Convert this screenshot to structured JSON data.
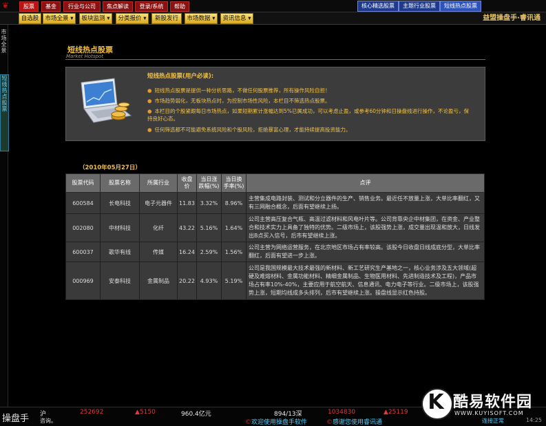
{
  "top_tabs": [
    {
      "label": "股票",
      "active": true
    },
    {
      "label": "基金",
      "active": false
    },
    {
      "label": "行业与公司",
      "active": false
    },
    {
      "label": "焦点解读",
      "active": false
    },
    {
      "label": "登录/系统",
      "active": false
    },
    {
      "label": "帮助",
      "active": false
    }
  ],
  "right_tabs": [
    "核心精选股票",
    "主题行业股票",
    "短线热点股票"
  ],
  "menu": [
    "自选股",
    "市场全景 ▾",
    "板块监测 ▾",
    "分类报价 ▾",
    "新股发行",
    "市场数据 ▾",
    "资讯信息 ▾"
  ],
  "brand": "益盟操盘手·睿讯通",
  "left_tabs": [
    {
      "label": "市场全景",
      "selected": false
    },
    {
      "label": "短线热点股票",
      "selected": true
    }
  ],
  "page": {
    "title": "短线热点股票",
    "subtitle": "Market Hotspot"
  },
  "notice": {
    "title": "短线热点股票(用户必读):",
    "items": [
      "短线热点股票是提供一种分析思路，不做任何股票推荐，所有操作风险自担！",
      "市场趋势弱化，无板块热点时，为控制市场性风险，本栏目不筛选热点股票。",
      "本栏目的个股紧跟每日市场热点，如果短期累计涨幅达到5%已属成功，可以考虑止盈，或参考60分钟和日操盘线进行操作，不论盈亏，保持良好心态。",
      "任何筛选都不可能避免系统风险和个股风险，拒绝暴富心理，才能持续提高投资能力。"
    ]
  },
  "date": "（2010年05月27日）",
  "table": {
    "headers": [
      "股票代码",
      "股票名称",
      "所属行业",
      "收盘价",
      "当日涨跌幅(%)",
      "当日换手率(%)",
      "点评"
    ],
    "rows": [
      {
        "code": "600584",
        "name": "长电科技",
        "industry": "电子元器件",
        "close": "11.83",
        "change": "3.32%",
        "turnover": "8.96%",
        "comment": "主营集成电路封装、测试和分立器件的生产、销售业务。最近任不放量上涨，大单比率翻红，又有三网融合概念，后面有望继续上扬。"
      },
      {
        "code": "002080",
        "name": "中材科技",
        "industry": "化纤",
        "close": "43.22",
        "change": "5.16%",
        "turnover": "1.64%",
        "comment": "公司主营高压复合气瓶、高温过滤材料和风电叶片等。公司背靠央企中材集团，在资金、产业整合和技术实力上具备了独特的优势。二级市场上，该股强势上涨，成交量出现温和放大，日线发出B点买入信号，后市有望继续上涨。"
      },
      {
        "code": "600037",
        "name": "歌华有线",
        "industry": "传媒",
        "close": "16.24",
        "change": "2.59%",
        "turnover": "1.56%",
        "comment": "公司主营为网络运营服务，在北京地区市场占有率较高。该股今日收盘日线成底分型，大单比率翻红，后面有望进一步上涨。"
      },
      {
        "code": "000969",
        "name": "安泰科技",
        "industry": "金属制品",
        "close": "20.22",
        "change": "4.93%",
        "turnover": "5.19%",
        "comment": "公司是我国规模最大技术最强的新材料、新工艺研究生产基地之一，核心业务涉及五大领域(超硬及难熔材料、金属功能材料、精细金属制品、生物医用材料、先进制造技术及工程)，产品市场占有率10%-40%，主要应用于航空航天、信息通讯、电力电子等行业。二级市场上，该股强势上涨，短期均线成多头排列，后市有望继续上涨。操盘线显示红色持股。"
      }
    ]
  },
  "bottom": {
    "brand": "操盘手",
    "market": "沪",
    "index": "252692",
    "delta": "▲5150",
    "amount": "960.4亿元",
    "scroll_msg": "欢迎使用操盘手软件",
    "ratio": "894/13深",
    "index2": "1034830",
    "delta2": "▲25119",
    "msg2": "感谢您使用睿讯通",
    "connect": "连接正常",
    "time": "14:25",
    "sub_left": "咨询。"
  },
  "watermark": {
    "letter": "K",
    "name": "酷易软件园",
    "url": "WWW.KUYISOFT.COM"
  },
  "colors": {
    "accent": "#f0c040",
    "red_tab": "#c01010",
    "blue_tab": "#1f3a8a"
  }
}
